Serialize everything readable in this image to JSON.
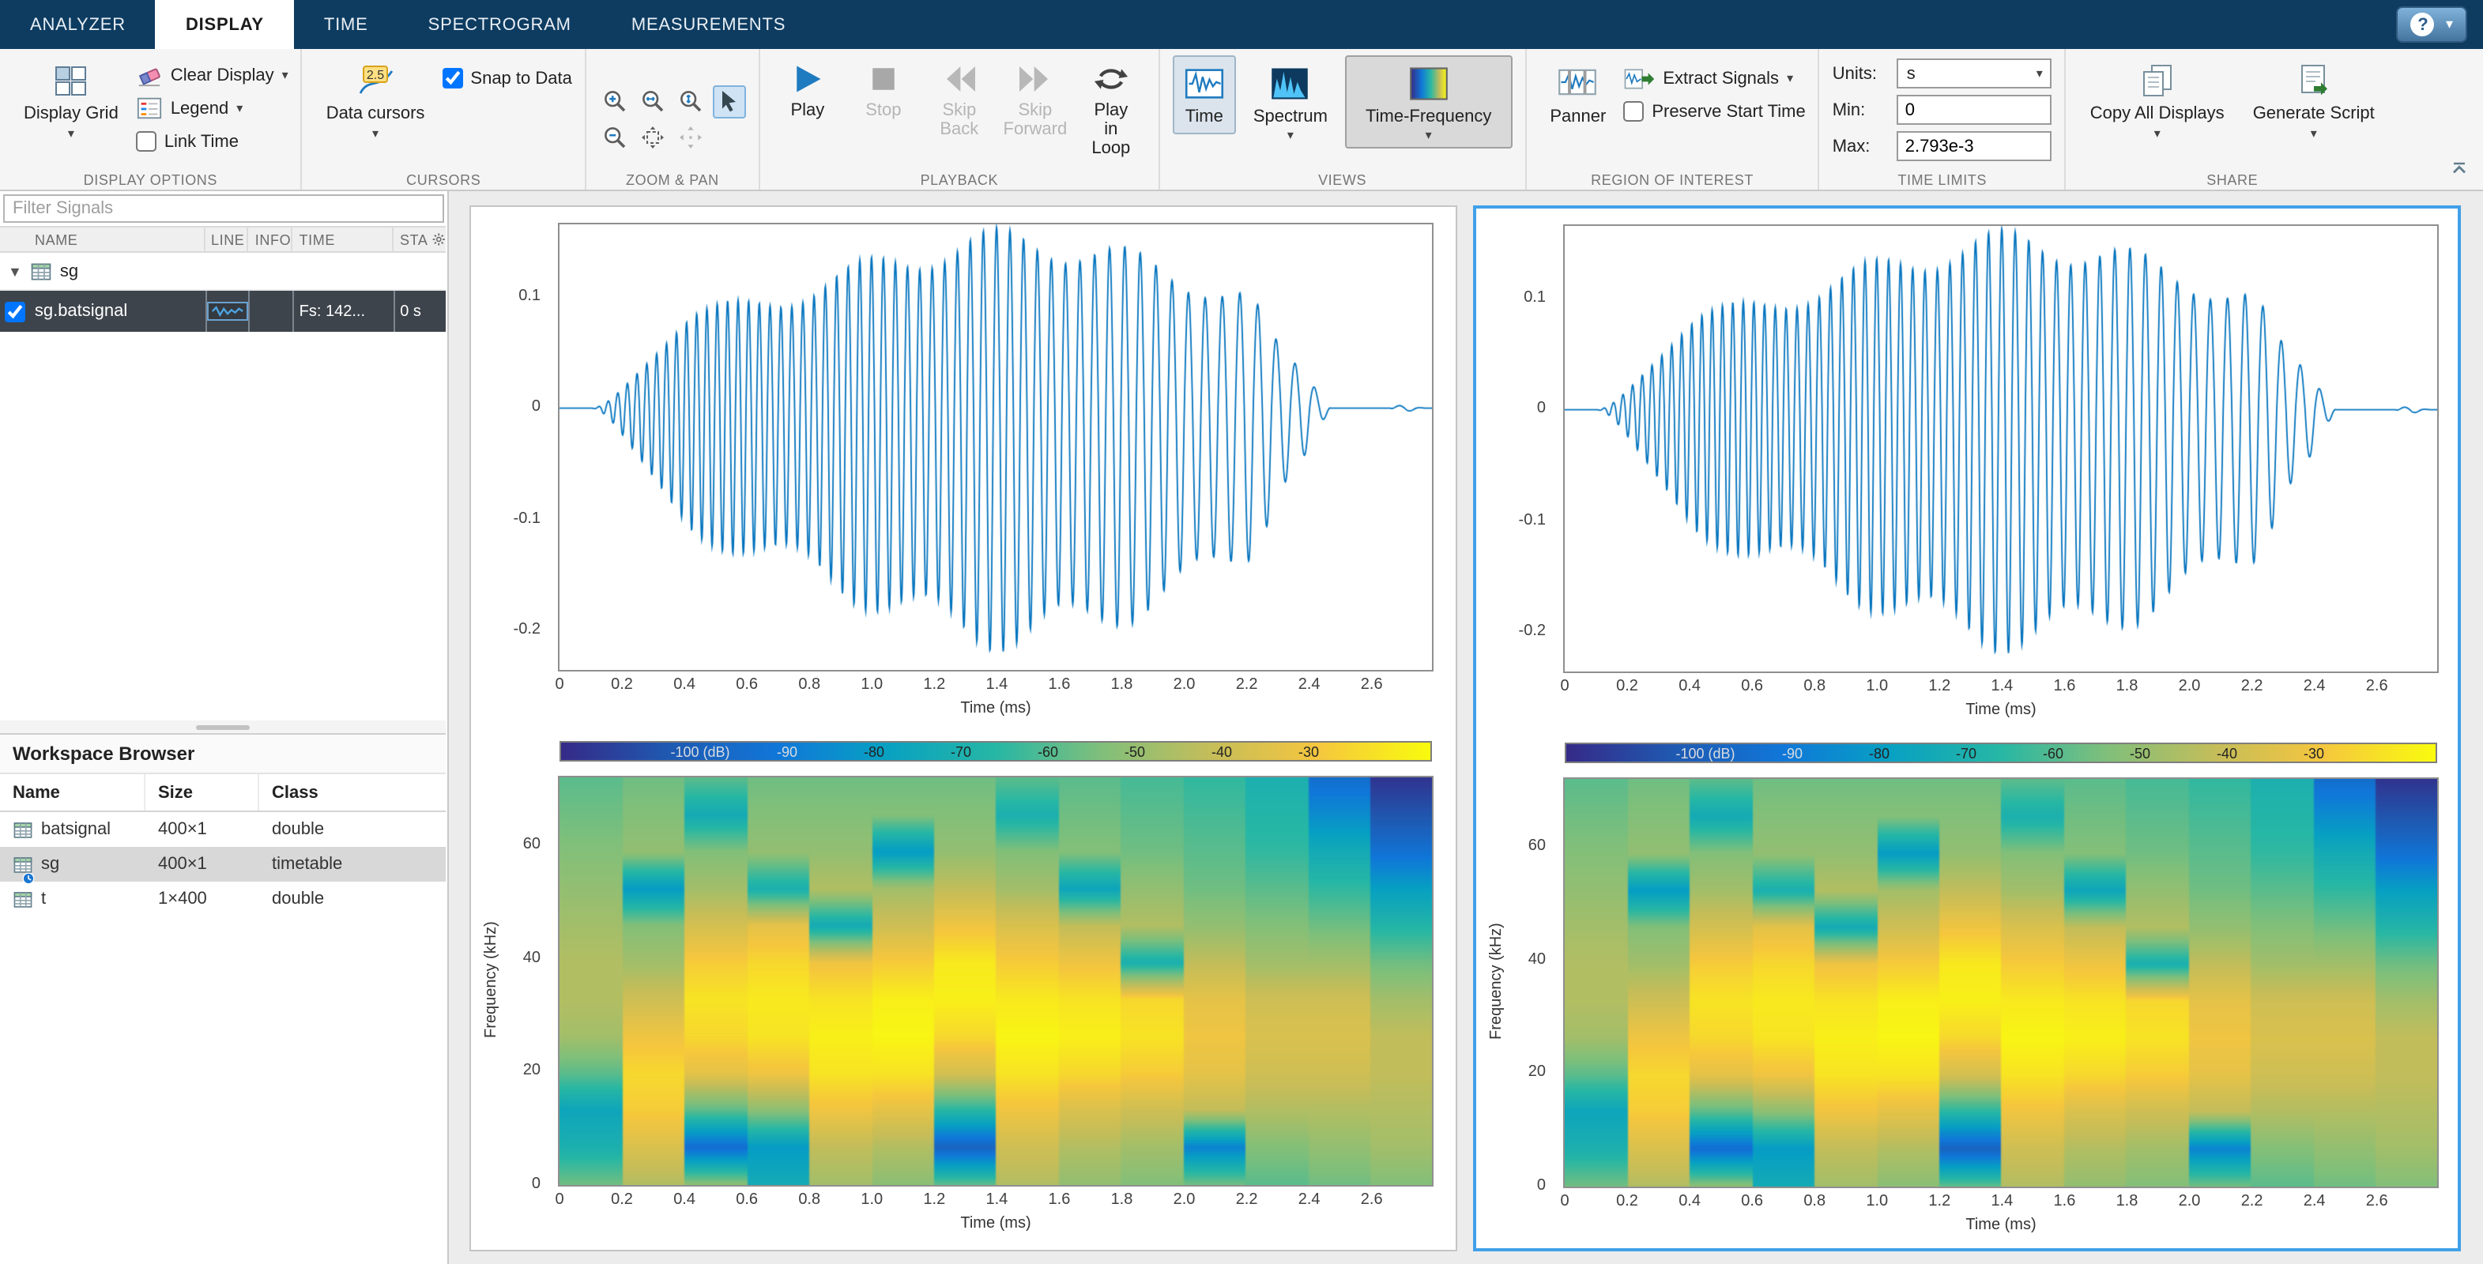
{
  "tabs": {
    "items": [
      {
        "label": "ANALYZER"
      },
      {
        "label": "DISPLAY"
      },
      {
        "label": "TIME"
      },
      {
        "label": "SPECTROGRAM"
      },
      {
        "label": "MEASUREMENTS"
      }
    ],
    "help": "?"
  },
  "ribbon": {
    "display_options": {
      "label": "DISPLAY OPTIONS",
      "display_grid": "Display Grid",
      "clear_display": "Clear Display",
      "legend": "Legend",
      "link_time": "Link Time"
    },
    "cursors": {
      "label": "CURSORS",
      "data_cursors": "Data cursors",
      "badge": "2.5",
      "snap": "Snap to Data"
    },
    "zoom_pan": {
      "label": "ZOOM & PAN"
    },
    "playback": {
      "label": "PLAYBACK",
      "play": "Play",
      "stop": "Stop",
      "skip_back": "Skip Back",
      "skip_forward": "Skip Forward",
      "loop": "Play in Loop"
    },
    "views": {
      "label": "VIEWS",
      "time": "Time",
      "spectrum": "Spectrum",
      "tf": "Time-Frequency"
    },
    "roi": {
      "label": "REGION OF INTEREST",
      "panner": "Panner",
      "extract": "Extract Signals",
      "preserve": "Preserve Start Time"
    },
    "time_limits": {
      "label": "TIME LIMITS",
      "units_label": "Units:",
      "units_value": "s",
      "min_label": "Min:",
      "min_value": "0",
      "max_label": "Max:",
      "max_value": "2.793e-3"
    },
    "share": {
      "label": "SHARE",
      "copy": "Copy All Displays",
      "generate": "Generate Script"
    }
  },
  "sidebar": {
    "filter_placeholder": "Filter Signals",
    "columns": [
      "NAME",
      "LINE",
      "INFO",
      "TIME",
      "STA"
    ],
    "group": "sg",
    "signal": {
      "name": "sg.batsignal",
      "fs": "Fs: 142...",
      "start": "0 s"
    },
    "workspace": {
      "title": "Workspace Browser",
      "columns": [
        "Name",
        "Size",
        "Class"
      ],
      "rows": [
        {
          "name": "batsignal",
          "size": "400×1",
          "class": "double"
        },
        {
          "name": "sg",
          "size": "400×1",
          "class": "timetable"
        },
        {
          "name": "t",
          "size": "1×400",
          "class": "double"
        }
      ]
    }
  },
  "chart_data": [
    {
      "type": "line",
      "name": "time-waveform",
      "color": "#0072BD",
      "xlabel": "Time (ms)",
      "xlim": [
        0,
        2.793
      ],
      "ylim": [
        -0.235,
        0.165
      ],
      "x_ticks": {
        "values": [
          0,
          0.2,
          0.4,
          0.6,
          0.8,
          1.0,
          1.2,
          1.4,
          1.6,
          1.8,
          2.0,
          2.2,
          2.4,
          2.6
        ],
        "labels": [
          "0",
          "0.2",
          "0.4",
          "0.6",
          "0.8",
          "1.0",
          "1.2",
          "1.4",
          "1.6",
          "1.8",
          "2.0",
          "2.2",
          "2.4",
          "2.6"
        ]
      },
      "y_ticks": {
        "values": [
          0.1,
          0,
          -0.1,
          -0.2
        ],
        "labels": [
          "0.1",
          "0",
          "-0.1",
          "-0.2"
        ]
      },
      "model": {
        "duration_ms": 2.793,
        "f_start_khz": 34,
        "f_end_khz": 13,
        "amp": 0.148,
        "neg_scale": 1.35,
        "attack_ms": [
          0.1,
          0.45
        ],
        "release_ms": [
          2.18,
          2.45
        ],
        "tail_amp": 0.02
      }
    },
    {
      "type": "heatmap",
      "name": "spectrogram",
      "xlabel": "Time (ms)",
      "ylabel": "Frequency (kHz)",
      "xlim": [
        0,
        2.793
      ],
      "ylim": [
        0,
        72
      ],
      "x_ticks": {
        "values": [
          0,
          0.2,
          0.4,
          0.6,
          0.8,
          1.0,
          1.2,
          1.4,
          1.6,
          1.8,
          2.0,
          2.2,
          2.4,
          2.6
        ],
        "labels": [
          "0",
          "0.2",
          "0.4",
          "0.6",
          "0.8",
          "1.0",
          "1.2",
          "1.4",
          "1.6",
          "1.8",
          "2.0",
          "2.2",
          "2.4",
          "2.6"
        ]
      },
      "y_ticks": {
        "values": [
          0,
          20,
          40,
          60
        ],
        "labels": [
          "0",
          "20",
          "40",
          "60"
        ]
      },
      "db_range": [
        -100,
        -30
      ],
      "colorbar": {
        "values": [
          -100,
          -90,
          -80,
          -70,
          -60,
          -50,
          -40,
          -30
        ],
        "labels": [
          "-100 (dB)",
          "-90",
          "-80",
          "-70",
          "-60",
          "-50",
          "-40",
          "-30"
        ]
      },
      "colormap": [
        [
          0,
          "#352a87"
        ],
        [
          0.12,
          "#2058b0"
        ],
        [
          0.25,
          "#1077d9"
        ],
        [
          0.37,
          "#07a0c3"
        ],
        [
          0.5,
          "#27b7a5"
        ],
        [
          0.62,
          "#7fbf7b"
        ],
        [
          0.75,
          "#c6bd59"
        ],
        [
          0.87,
          "#f5c63f"
        ],
        [
          1,
          "#f9fb0e"
        ]
      ],
      "grid_columns": [
        [
          -58,
          -68,
          -72,
          -60,
          -52,
          -50,
          -50,
          -52,
          -54,
          -56,
          -58,
          -60
        ],
        [
          -50,
          -44,
          -38,
          -36,
          -40,
          -46,
          -52,
          -56,
          -75,
          -54,
          -56,
          -58
        ],
        [
          -55,
          -85,
          -60,
          -42,
          -36,
          -34,
          -38,
          -45,
          -52,
          -56,
          -70,
          -60
        ],
        [
          -70,
          -75,
          -55,
          -40,
          -34,
          -33,
          -36,
          -42,
          -68,
          -54,
          -56,
          -58
        ],
        [
          -52,
          -48,
          -40,
          -34,
          -32,
          -34,
          -40,
          -70,
          -50,
          -54,
          -56,
          -58
        ],
        [
          -55,
          -50,
          -42,
          -34,
          -31,
          -32,
          -38,
          -46,
          -52,
          -75,
          -56,
          -58
        ],
        [
          -60,
          -88,
          -65,
          -45,
          -36,
          -32,
          -33,
          -40,
          -48,
          -54,
          -56,
          -58
        ],
        [
          -50,
          -46,
          -40,
          -34,
          -31,
          -33,
          -38,
          -44,
          -52,
          -56,
          -68,
          -60
        ],
        [
          -54,
          -50,
          -44,
          -36,
          -32,
          -34,
          -40,
          -48,
          -72,
          -56,
          -58,
          -60
        ],
        [
          -56,
          -52,
          -46,
          -38,
          -34,
          -36,
          -68,
          -50,
          -54,
          -58,
          -60,
          -62
        ],
        [
          -58,
          -80,
          -48,
          -42,
          -40,
          -42,
          -48,
          -54,
          -58,
          -60,
          -62,
          -64
        ],
        [
          -60,
          -56,
          -50,
          -46,
          -44,
          -46,
          -52,
          -56,
          -60,
          -64,
          -66,
          -68
        ],
        [
          -58,
          -54,
          -50,
          -46,
          -44,
          -46,
          -52,
          -58,
          -64,
          -70,
          -78,
          -85
        ],
        [
          -56,
          -52,
          -50,
          -48,
          -48,
          -52,
          -58,
          -66,
          -74,
          -84,
          -92,
          -98
        ]
      ]
    }
  ]
}
